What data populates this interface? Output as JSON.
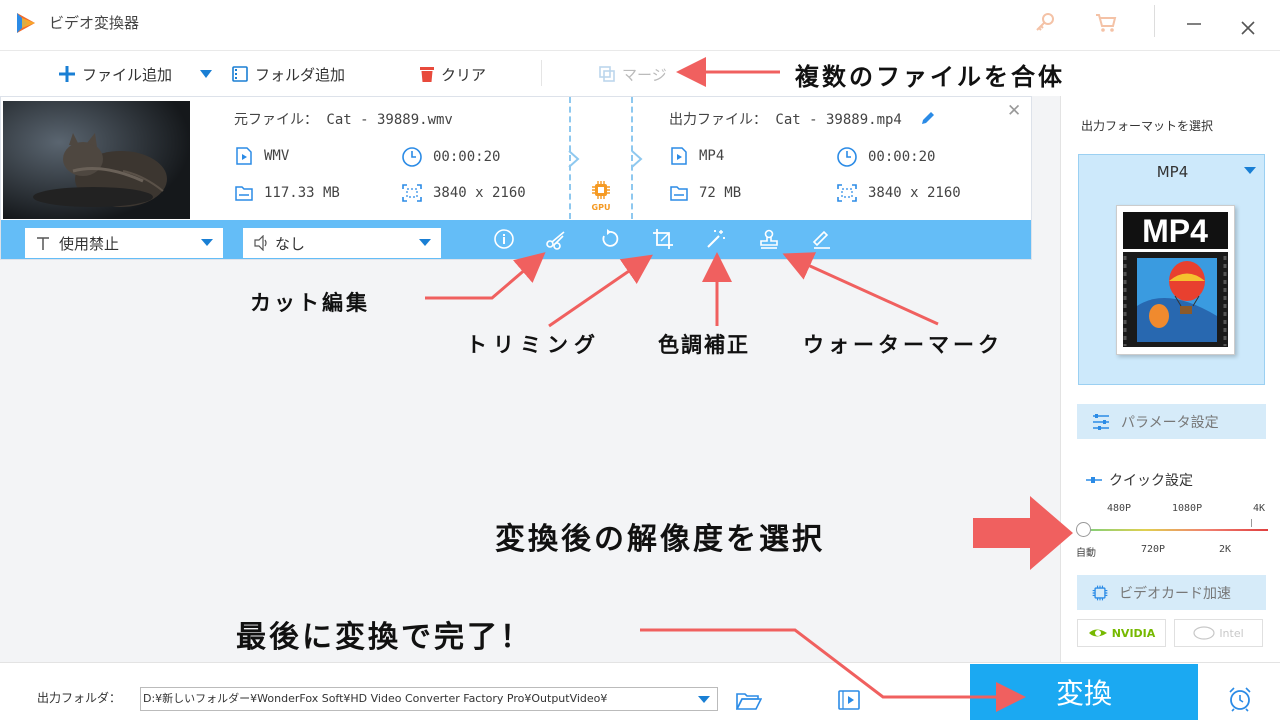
{
  "window": {
    "title": "ビデオ変換器"
  },
  "toolbar": {
    "add_file": "ファイル追加",
    "add_folder": "フォルダ追加",
    "clear": "クリア",
    "merge": "マージ"
  },
  "file": {
    "source_title": "元ファイル： Cat - 39889.wmv",
    "source_format": "WMV",
    "source_duration": "00:00:20",
    "source_size": "117.33 MB",
    "source_resolution": "3840 x 2160",
    "gpu_label": "GPU",
    "output_title": "出力ファイル： Cat - 39889.mp4",
    "output_format": "MP4",
    "output_duration": "00:00:20",
    "output_size": "72 MB",
    "output_resolution": "3840 x 2160"
  },
  "actionbar": {
    "subtitle": "使用禁止",
    "audio": "なし"
  },
  "right_panel": {
    "select_format_label": "出力フォーマットを選択",
    "format": "MP4",
    "format_image_text": "MP4",
    "param_settings": "パラメータ設定",
    "quick_settings": "クイック設定",
    "res_top": [
      "480P",
      "1080P",
      "4K"
    ],
    "res_bottom": [
      "自動",
      "720P",
      "2K"
    ],
    "gpu_accel": "ビデオカード加速",
    "nvidia": "NVIDIA",
    "intel": "Intel"
  },
  "bottom": {
    "output_folder_label": "出力フォルダ：",
    "output_path": "D:¥新しいフォルダー¥WonderFox Soft¥HD Video Converter Factory Pro¥OutputVideo¥",
    "convert": "変換"
  },
  "annotations": {
    "merge": "複数のファイルを合体",
    "cut": "カット編集",
    "trim": "トリミング",
    "color": "色調補正",
    "watermark": "ウォーターマーク",
    "resolution": "変換後の解像度を選択",
    "finish": "最後に変換で完了！"
  },
  "colors": {
    "accent_blue": "#64bdf7",
    "convert_blue": "#1ba9f2",
    "annotation_red": "#f0605f"
  }
}
